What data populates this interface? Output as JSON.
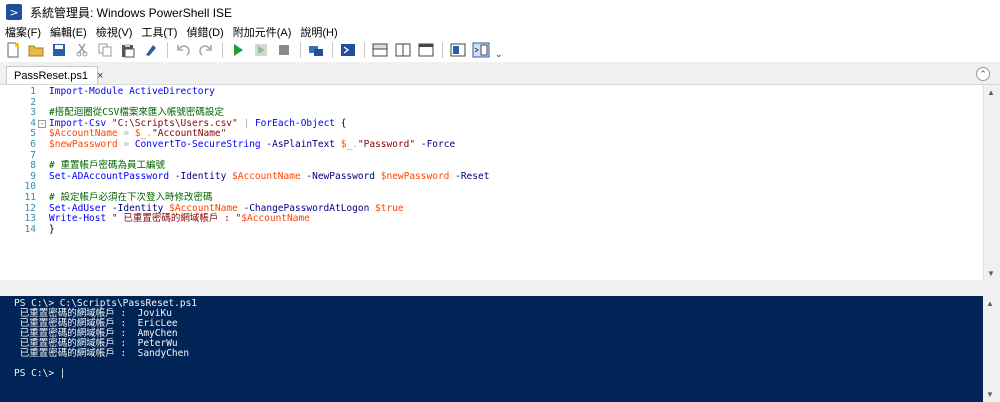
{
  "window": {
    "title": "系統管理員: Windows PowerShell ISE",
    "app_icon": "powershell-ise-icon"
  },
  "menu": [
    "檔案(F)",
    "編輯(E)",
    "檢視(V)",
    "工具(T)",
    "偵錯(D)",
    "附加元件(A)",
    "說明(H)"
  ],
  "toolbar": {
    "icons": [
      "new-file-icon",
      "open-folder-icon",
      "save-icon",
      "cut-icon",
      "copy-icon",
      "paste-icon",
      "clear-console-icon",
      "undo-icon",
      "redo-icon",
      "run-icon",
      "run-selection-icon",
      "stop-icon",
      "remote-powershell-icon",
      "powershell-console-icon",
      "script-pane-top-icon",
      "script-pane-right-icon",
      "script-pane-max-icon",
      "show-command-icon",
      "show-addon-icon"
    ],
    "overflow": "⌄"
  },
  "tab": {
    "label": "PassReset.ps1",
    "close": "×",
    "collapse": "⌃"
  },
  "editor": {
    "line_numbers": [
      "1",
      "2",
      "3",
      "4",
      "5",
      "6",
      "7",
      "8",
      "9",
      "10",
      "11",
      "12",
      "13",
      "14"
    ],
    "fold_marker": "-",
    "lines": [
      [
        {
          "t": "Import-Module ActiveDirectory",
          "c": "c-cmd"
        }
      ],
      [],
      [
        {
          "t": "#搭配迴圈從CSV檔案來匯入帳號密碼設定",
          "c": "c-cmt"
        }
      ],
      [
        {
          "t": "Import-Csv ",
          "c": "c-cmd"
        },
        {
          "t": "\"C:\\Scripts\\Users.csv\"",
          "c": "c-str"
        },
        {
          "t": " | ",
          "c": "c-op"
        },
        {
          "t": "ForEach-Object",
          "c": "c-cmd"
        },
        {
          "t": " {",
          "c": "c-prop"
        }
      ],
      [
        {
          "t": "$AccountName",
          "c": "c-var"
        },
        {
          "t": " = ",
          "c": "c-op"
        },
        {
          "t": "$_",
          "c": "c-var"
        },
        {
          "t": ".",
          "c": "c-op"
        },
        {
          "t": "\"AccountName\"",
          "c": "c-str"
        }
      ],
      [
        {
          "t": "$newPassword",
          "c": "c-var"
        },
        {
          "t": " = ",
          "c": "c-op"
        },
        {
          "t": "ConvertTo-SecureString",
          "c": "c-cmd"
        },
        {
          "t": " -AsPlainText ",
          "c": "c-param"
        },
        {
          "t": "$_",
          "c": "c-var"
        },
        {
          "t": ".",
          "c": "c-op"
        },
        {
          "t": "\"Password\"",
          "c": "c-str"
        },
        {
          "t": " -Force",
          "c": "c-param"
        }
      ],
      [],
      [
        {
          "t": "# 重置帳戶密碼為員工編號",
          "c": "c-cmt"
        }
      ],
      [
        {
          "t": "Set-ADAccountPassword",
          "c": "c-cmd"
        },
        {
          "t": " -Identity ",
          "c": "c-param"
        },
        {
          "t": "$AccountName",
          "c": "c-var"
        },
        {
          "t": " -NewPassword ",
          "c": "c-param"
        },
        {
          "t": "$newPassword",
          "c": "c-var"
        },
        {
          "t": " -Reset",
          "c": "c-param"
        }
      ],
      [],
      [
        {
          "t": "# 設定帳戶必須在下次登入時修改密碼",
          "c": "c-cmt"
        }
      ],
      [
        {
          "t": "Set-AdUser",
          "c": "c-cmd"
        },
        {
          "t": " -Identity ",
          "c": "c-param"
        },
        {
          "t": "$AccountName",
          "c": "c-var"
        },
        {
          "t": " -ChangePasswordAtLogon ",
          "c": "c-param"
        },
        {
          "t": "$true",
          "c": "c-var"
        }
      ],
      [
        {
          "t": "Write-Host",
          "c": "c-cmd"
        },
        {
          "t": " \" 已重置密碼的網域帳戶 : \"",
          "c": "c-str"
        },
        {
          "t": "$AccountName",
          "c": "c-var"
        }
      ],
      [
        {
          "t": "}",
          "c": "c-prop"
        }
      ]
    ]
  },
  "console": {
    "lines": [
      "PS C:\\> C:\\Scripts\\PassReset.ps1",
      " 已重置密碼的網域帳戶 :  JoviKu",
      " 已重置密碼的網域帳戶 :  EricLee",
      " 已重置密碼的網域帳戶 :  AmyChen",
      " 已重置密碼的網域帳戶 :  PeterWu",
      " 已重置密碼的網域帳戶 :  SandyChen",
      "",
      "PS C:\\> |"
    ]
  },
  "colors": {
    "console_bg": "#012456",
    "console_fg": "#f5f5f5",
    "line_number": "#2b91af"
  }
}
